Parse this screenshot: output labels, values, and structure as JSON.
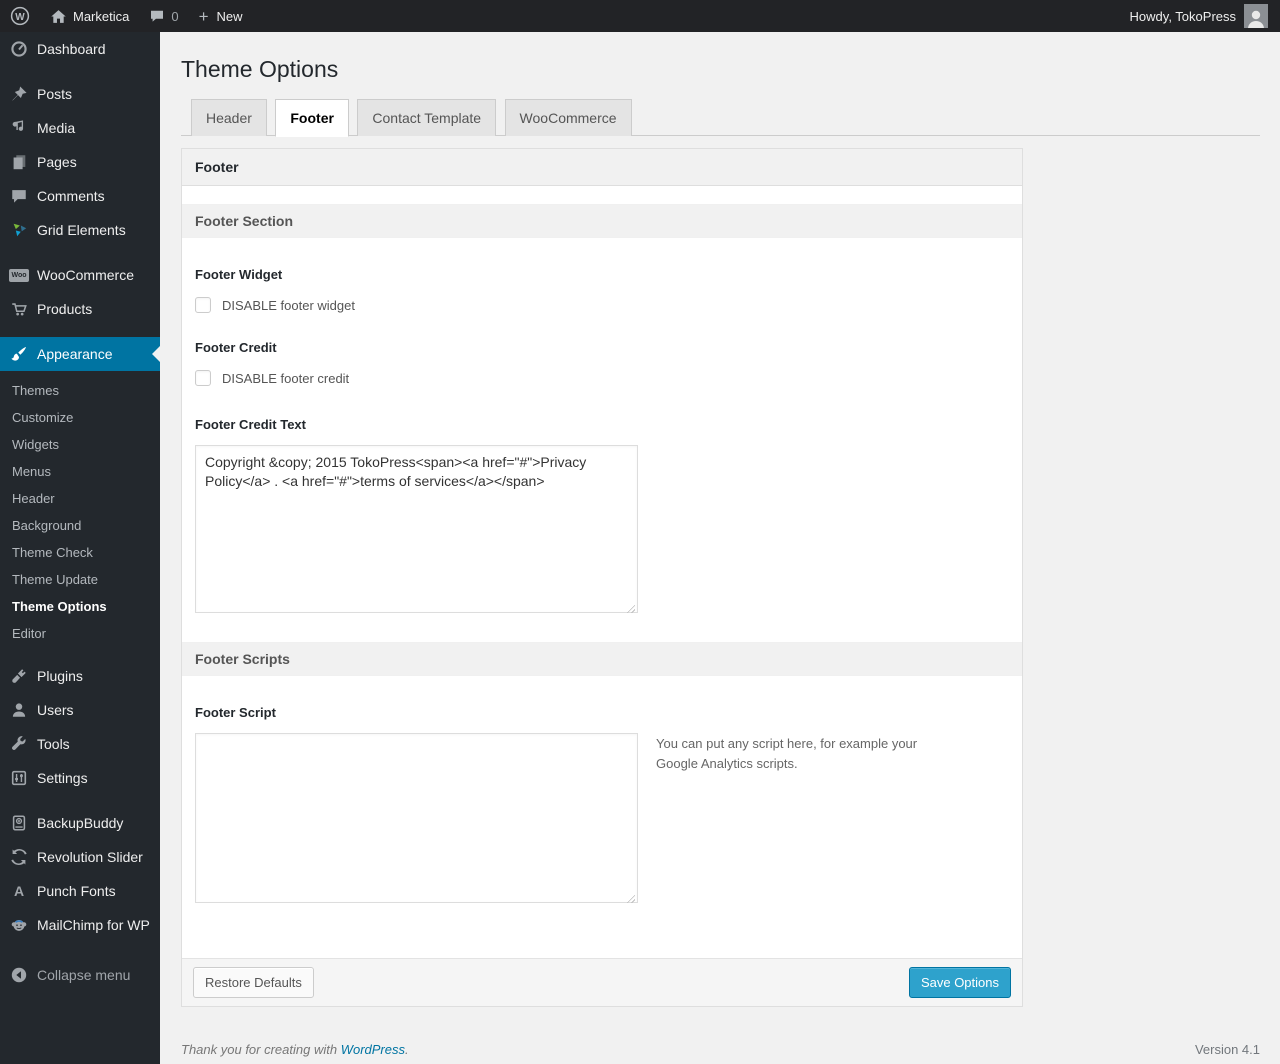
{
  "admin_bar": {
    "site_name": "Marketica",
    "comment_count": "0",
    "new_label": "New",
    "plus": "+",
    "howdy": "Howdy, TokoPress",
    "wp_logo_letter": "W"
  },
  "sidebar": {
    "items": [
      {
        "label": "Dashboard",
        "icon": "dashboard-icon"
      },
      {
        "label": "Posts",
        "icon": "posts-icon"
      },
      {
        "label": "Media",
        "icon": "media-icon"
      },
      {
        "label": "Pages",
        "icon": "pages-icon"
      },
      {
        "label": "Comments",
        "icon": "comments-icon"
      },
      {
        "label": "Grid Elements",
        "icon": "grid-elements-icon"
      },
      {
        "label": "WooCommerce",
        "icon": "woocommerce-icon",
        "badge": "Woo"
      },
      {
        "label": "Products",
        "icon": "products-icon"
      },
      {
        "label": "Appearance",
        "icon": "appearance-icon",
        "active": true
      },
      {
        "label": "Plugins",
        "icon": "plugins-icon"
      },
      {
        "label": "Users",
        "icon": "users-icon"
      },
      {
        "label": "Tools",
        "icon": "tools-icon"
      },
      {
        "label": "Settings",
        "icon": "settings-icon"
      },
      {
        "label": "BackupBuddy",
        "icon": "backupbuddy-icon"
      },
      {
        "label": "Revolution Slider",
        "icon": "revolution-slider-icon"
      },
      {
        "label": "Punch Fonts",
        "icon": "punch-fonts-icon",
        "letter": "A"
      },
      {
        "label": "MailChimp for WP",
        "icon": "mailchimp-icon"
      },
      {
        "label": "Collapse menu",
        "icon": "collapse-icon"
      }
    ],
    "appearance_submenu": [
      {
        "label": "Themes"
      },
      {
        "label": "Customize"
      },
      {
        "label": "Widgets"
      },
      {
        "label": "Menus"
      },
      {
        "label": "Header"
      },
      {
        "label": "Background"
      },
      {
        "label": "Theme Check"
      },
      {
        "label": "Theme Update"
      },
      {
        "label": "Theme Options",
        "current": true
      },
      {
        "label": "Editor"
      }
    ]
  },
  "page": {
    "title": "Theme Options",
    "tabs": [
      {
        "label": "Header",
        "active": false
      },
      {
        "label": "Footer",
        "active": true
      },
      {
        "label": "Contact Template",
        "active": false
      },
      {
        "label": "WooCommerce",
        "active": false
      }
    ]
  },
  "panel": {
    "header": "Footer",
    "footer_section_title": "Footer Section",
    "footer_widget_label": "Footer Widget",
    "footer_widget_checkbox_label": "DISABLE footer widget",
    "footer_credit_label": "Footer Credit",
    "footer_credit_checkbox_label": "DISABLE footer credit",
    "footer_credit_text_label": "Footer Credit Text",
    "footer_credit_text_value": "Copyright &copy; 2015 TokoPress<span><a href=\"#\">Privacy Policy</a> . <a href=\"#\">terms of services</a></span>",
    "footer_scripts_title": "Footer Scripts",
    "footer_script_label": "Footer Script",
    "footer_script_value": "",
    "footer_script_help": "You can put any script here, for example your Google Analytics scripts.",
    "restore_button_label": "Restore Defaults",
    "save_button_label": "Save Options"
  },
  "footer": {
    "thanks_prefix": "Thank you for creating with ",
    "thanks_link": "WordPress",
    "thanks_suffix": ".",
    "version": "Version 4.1"
  },
  "colors": {
    "accent_blue": "#0074a2",
    "button_primary": "#2ea2cc",
    "adminbar_bg": "#222326",
    "sidebar_bg": "#23282d",
    "page_bg": "#f1f1f1"
  }
}
